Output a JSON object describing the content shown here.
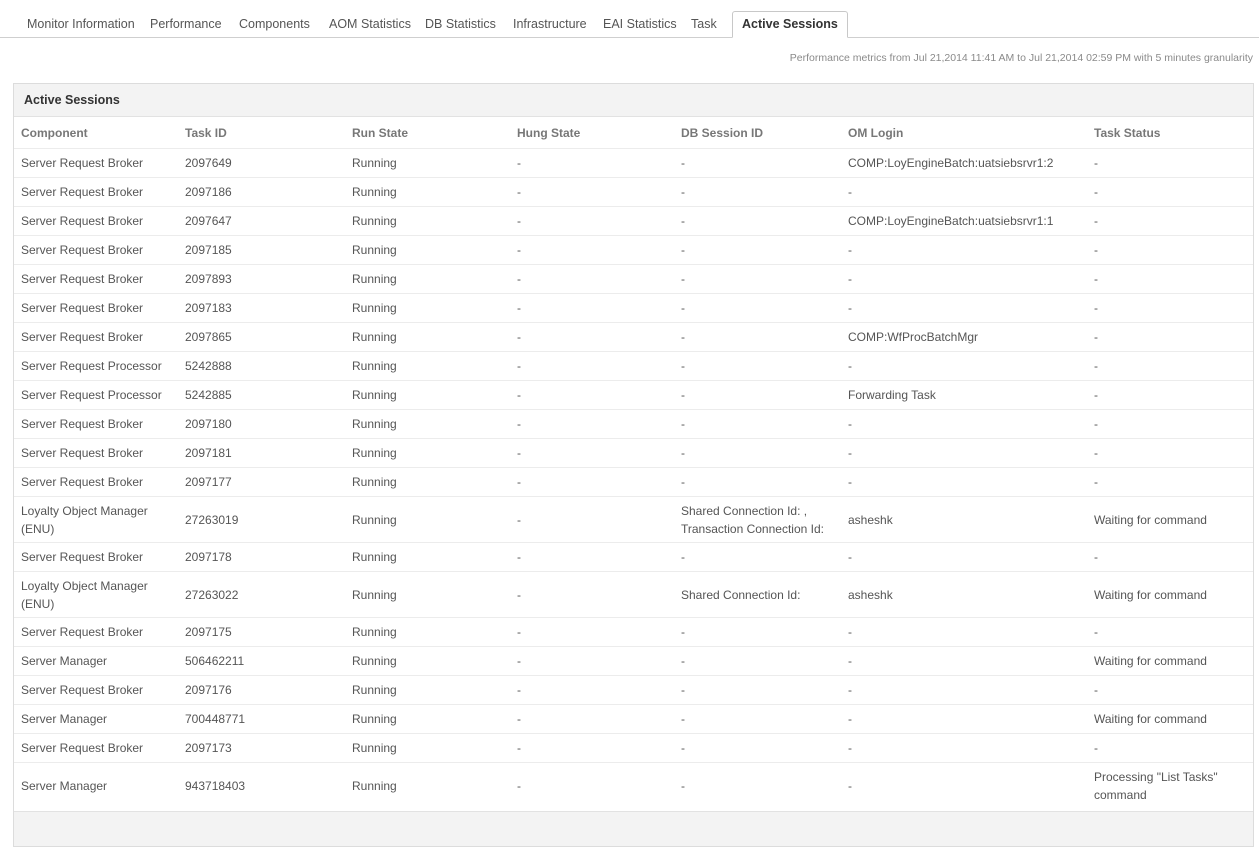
{
  "tabs": [
    {
      "label": "Monitor Information"
    },
    {
      "label": "Performance"
    },
    {
      "label": "Components"
    },
    {
      "label": "AOM Statistics"
    },
    {
      "label": "DB Statistics"
    },
    {
      "label": "Infrastructure"
    },
    {
      "label": "EAI Statistics"
    },
    {
      "label": "Task"
    },
    {
      "label": "Active Sessions"
    }
  ],
  "active_tab": "Active Sessions",
  "metrics_note": "Performance metrics from Jul 21,2014 11:41 AM to Jul 21,2014 02:59 PM with 5 minutes granularity",
  "panel": {
    "title": "Active Sessions",
    "columns": [
      "Component",
      "Task ID",
      "Run State",
      "Hung State",
      "DB Session ID",
      "OM Login",
      "Task Status"
    ],
    "rows": [
      [
        "Server Request Broker",
        "2097649",
        "Running",
        "-",
        "-",
        "COMP:LoyEngineBatch:uatsiebsrvr1:2",
        "-"
      ],
      [
        "Server Request Broker",
        "2097186",
        "Running",
        "-",
        "-",
        "-",
        "-"
      ],
      [
        "Server Request Broker",
        "2097647",
        "Running",
        "-",
        "-",
        "COMP:LoyEngineBatch:uatsiebsrvr1:1",
        "-"
      ],
      [
        "Server Request Broker",
        "2097185",
        "Running",
        "-",
        "-",
        "-",
        "-"
      ],
      [
        "Server Request Broker",
        "2097893",
        "Running",
        "-",
        "-",
        "-",
        "-"
      ],
      [
        "Server Request Broker",
        "2097183",
        "Running",
        "-",
        "-",
        "-",
        "-"
      ],
      [
        "Server Request Broker",
        "2097865",
        "Running",
        "-",
        "-",
        "COMP:WfProcBatchMgr",
        "-"
      ],
      [
        "Server Request Processor",
        "5242888",
        "Running",
        "-",
        "-",
        "-",
        "-"
      ],
      [
        "Server Request Processor",
        "5242885",
        "Running",
        "-",
        "-",
        "Forwarding Task",
        "-"
      ],
      [
        "Server Request Broker",
        "2097180",
        "Running",
        "-",
        "-",
        "-",
        "-"
      ],
      [
        "Server Request Broker",
        "2097181",
        "Running",
        "-",
        "-",
        "-",
        "-"
      ],
      [
        "Server Request Broker",
        "2097177",
        "Running",
        "-",
        "-",
        "-",
        "-"
      ],
      [
        "Loyalty Object Manager (ENU)",
        "27263019",
        "Running",
        "-",
        "Shared Connection Id: , Transaction Connection Id:",
        "asheshk",
        "Waiting for command"
      ],
      [
        "Server Request Broker",
        "2097178",
        "Running",
        "-",
        "-",
        "-",
        "-"
      ],
      [
        "Loyalty Object Manager (ENU)",
        "27263022",
        "Running",
        "-",
        "Shared Connection Id:",
        "asheshk",
        "Waiting for command"
      ],
      [
        "Server Request Broker",
        "2097175",
        "Running",
        "-",
        "-",
        "-",
        "-"
      ],
      [
        "Server Manager",
        "506462211",
        "Running",
        "-",
        "-",
        "-",
        "Waiting for command"
      ],
      [
        "Server Request Broker",
        "2097176",
        "Running",
        "-",
        "-",
        "-",
        "-"
      ],
      [
        "Server Manager",
        "700448771",
        "Running",
        "-",
        "-",
        "-",
        "Waiting for command"
      ],
      [
        "Server Request Broker",
        "2097173",
        "Running",
        "-",
        "-",
        "-",
        "-"
      ],
      [
        "Server Manager",
        "943718403",
        "Running",
        "-",
        "-",
        "-",
        "Processing \"List Tasks\" command"
      ]
    ]
  }
}
